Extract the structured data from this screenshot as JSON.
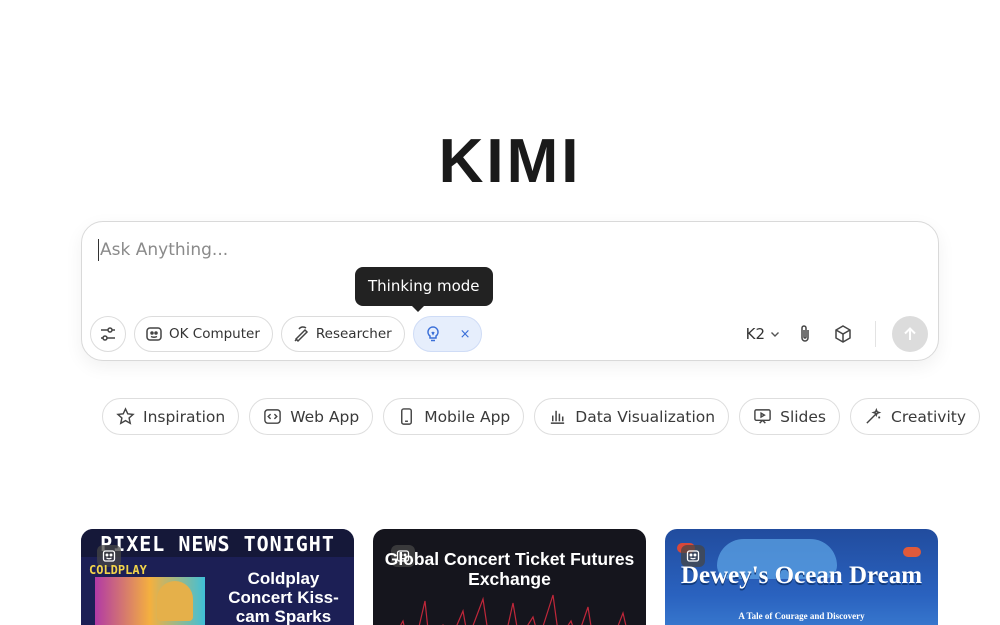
{
  "logo": {
    "text": "KIMI"
  },
  "input": {
    "placeholder": "Ask Anything...",
    "tools": {
      "settings_icon": "sliders-icon",
      "ok_computer_label": "OK Computer",
      "researcher_label": "Researcher",
      "thinking_mode_icon": "lightbulb-icon",
      "thinking_close": "×"
    },
    "tooltip": "Thinking mode",
    "model": "K2",
    "attach_icon": "paperclip-icon",
    "cube_icon": "cube-icon",
    "send_icon": "arrow-up-icon"
  },
  "categories": [
    {
      "label": "Inspiration",
      "icon": "star-icon"
    },
    {
      "label": "Web App",
      "icon": "code-icon"
    },
    {
      "label": "Mobile App",
      "icon": "phone-icon"
    },
    {
      "label": "Data Visualization",
      "icon": "bar-chart-icon"
    },
    {
      "label": "Slides",
      "icon": "presentation-icon"
    },
    {
      "label": "Creativity",
      "icon": "magic-wand-icon"
    }
  ],
  "cards": [
    {
      "header": "PIXEL NEWS TONIGHT",
      "sub": "COLDPLAY",
      "text": "Coldplay Concert Kiss-cam Sparks"
    },
    {
      "title": "Global Concert Ticket Futures Exchange"
    },
    {
      "title": "Dewey's Ocean Dream",
      "subtitle": "A Tale of Courage and Discovery"
    }
  ],
  "colors": {
    "accent": "#3a6fd8",
    "active_pill_bg": "#e6eefc",
    "tooltip_bg": "#222222",
    "send_disabled": "#dcdcdc"
  }
}
